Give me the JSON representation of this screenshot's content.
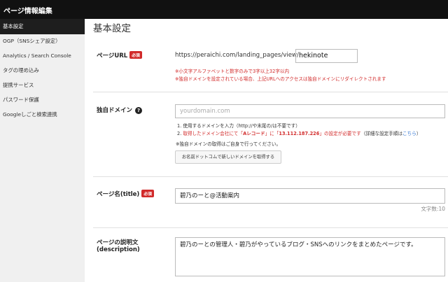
{
  "topbar": {
    "title": "ページ情報編集"
  },
  "sidebar": {
    "items": [
      {
        "label": "基本設定",
        "active": true
      },
      {
        "label": "OGP（SNSシェア設定）"
      },
      {
        "label": "Analytics / Search Console"
      },
      {
        "label": "タグの埋め込み"
      },
      {
        "label": "提携サービス"
      },
      {
        "label": "パスワード保護"
      },
      {
        "label": "Googleしごと検索連携"
      }
    ]
  },
  "main": {
    "title": "基本設定",
    "page_url": {
      "label": "ページURL",
      "badge": "必須",
      "prefix": "https://peraichi.com/landing_pages/view/",
      "value": "hekinote",
      "note1": "※小文字アルファベットと数字のみで3字以上32字以内",
      "note2": "※独自ドメインを設定されている場合、上記URLへのアクセスは独自ドメインにリダイレクトされます"
    },
    "domain": {
      "label": "独自ドメイン",
      "help_icon": "?",
      "placeholder": "yourdomain.com",
      "note1": "1. 使用するドメインを入力（http://や末尾の/は不要です）",
      "note2_prefix": "2. ",
      "note2_red_a": "取得したドメイン会社にて「",
      "note2_bold_a": "Aレコード",
      "note2_red_b": "」に「",
      "note2_bold_b": "13.112.187.226",
      "note2_red_c": "」の設定が必要です",
      "note2_tail": "（詳細な設定手順は",
      "note2_link": "こちら",
      "note2_end": "）",
      "note3": "※独自ドメインの取得はご自身で行ってください。",
      "button": "お名前ドットコムで新しいドメインを取得する"
    },
    "page_title": {
      "label": "ページ名(title)",
      "badge": "必須",
      "value": "碧乃のーと@活動案内",
      "char_count": "文字数:10"
    },
    "description": {
      "label_line1": "ページの説明文",
      "label_line2": "(description)",
      "value": "碧乃のーとの管理人・碧乃がやっているブログ・SNSへのリンクをまとめたページです。"
    }
  }
}
